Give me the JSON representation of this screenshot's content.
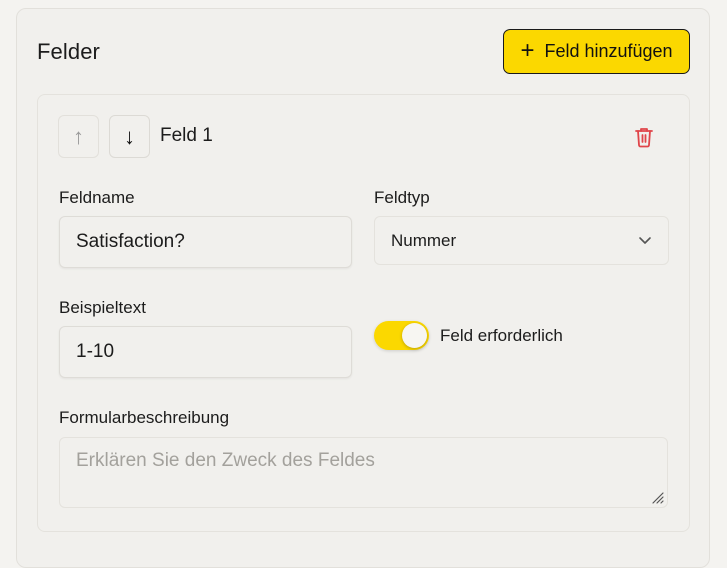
{
  "section": {
    "title": "Felder",
    "add_button_label": "Feld hinzufügen"
  },
  "field": {
    "title": "Feld 1",
    "move_up_glyph": "↑",
    "move_down_glyph": "↓",
    "name_label": "Feldname",
    "name_value": "Satisfaction?",
    "type_label": "Feldtyp",
    "type_value": "Nummer",
    "example_label": "Beispieltext",
    "example_value": "1-10",
    "required_label": "Feld erforderlich",
    "required": true,
    "description_label": "Formularbeschreibung",
    "description_placeholder": "Erklären Sie den Zweck des Feldes",
    "description_value": ""
  },
  "icons": {
    "add": "plus-icon",
    "delete": "trash-icon",
    "dropdown": "chevron-down-icon",
    "resize": "resize-handle-icon"
  },
  "colors": {
    "accent": "#fbd800",
    "danger": "#e0454a",
    "background": "#f1f0ed"
  }
}
